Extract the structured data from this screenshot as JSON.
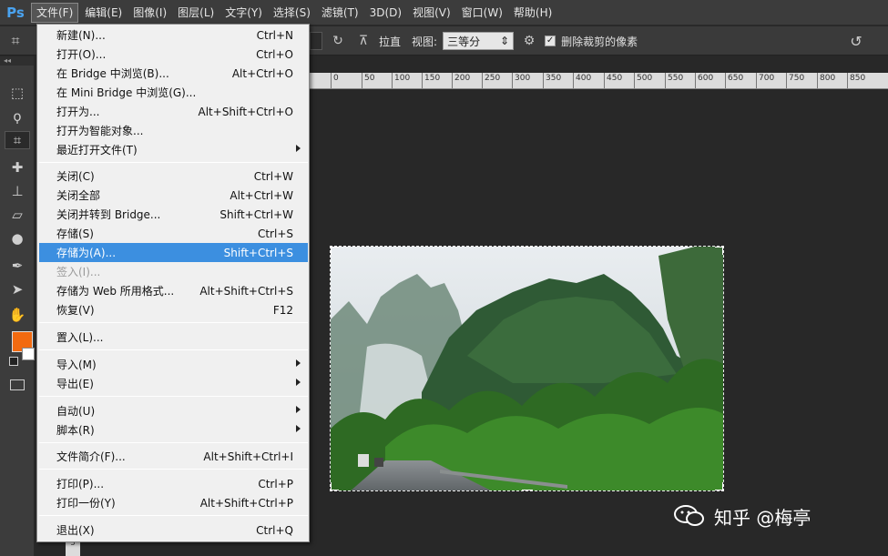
{
  "app": {
    "logo": "Ps"
  },
  "menubar": {
    "items": [
      "文件(F)",
      "编辑(E)",
      "图像(I)",
      "图层(L)",
      "文字(Y)",
      "选择(S)",
      "滤镜(T)",
      "3D(D)",
      "视图(V)",
      "窗口(W)",
      "帮助(H)"
    ],
    "active_index": 0
  },
  "options_bar": {
    "straighten_label": "拉直",
    "view_label": "视图:",
    "view_select_value": "三等分",
    "delete_cropped_label": "删除裁剪的像素",
    "delete_cropped_checked": true
  },
  "ruler": {
    "ticks": [
      "0",
      "50",
      "100",
      "150",
      "200",
      "250",
      "300",
      "350",
      "400",
      "450",
      "500",
      "550",
      "600",
      "650",
      "700",
      "750",
      "800",
      "850"
    ]
  },
  "vruler": {
    "label": "5"
  },
  "colors": {
    "foreground": "#f26a10",
    "background": "#ffffff",
    "menu_highlight": "#3c8fe0",
    "ps_logo": "#4aa3f0"
  },
  "file_menu": {
    "items": [
      {
        "label": "新建(N)...",
        "shortcut": "Ctrl+N"
      },
      {
        "label": "打开(O)...",
        "shortcut": "Ctrl+O"
      },
      {
        "label": "在 Bridge 中浏览(B)...",
        "shortcut": "Alt+Ctrl+O"
      },
      {
        "label": "在 Mini Bridge 中浏览(G)...",
        "shortcut": ""
      },
      {
        "label": "打开为...",
        "shortcut": "Alt+Shift+Ctrl+O"
      },
      {
        "label": "打开为智能对象...",
        "shortcut": ""
      },
      {
        "label": "最近打开文件(T)",
        "shortcut": "",
        "submenu": true
      },
      {
        "label": "关闭(C)",
        "shortcut": "Ctrl+W"
      },
      {
        "label": "关闭全部",
        "shortcut": "Alt+Ctrl+W"
      },
      {
        "label": "关闭并转到 Bridge...",
        "shortcut": "Shift+Ctrl+W"
      },
      {
        "label": "存储(S)",
        "shortcut": "Ctrl+S"
      },
      {
        "label": "存储为(A)...",
        "shortcut": "Shift+Ctrl+S",
        "highlighted": true
      },
      {
        "label": "签入(I)...",
        "shortcut": "",
        "disabled": true
      },
      {
        "label": "存储为 Web 所用格式...",
        "shortcut": "Alt+Shift+Ctrl+S"
      },
      {
        "label": "恢复(V)",
        "shortcut": "F12"
      },
      {
        "label": "置入(L)...",
        "shortcut": ""
      },
      {
        "label": "导入(M)",
        "shortcut": "",
        "submenu": true
      },
      {
        "label": "导出(E)",
        "shortcut": "",
        "submenu": true
      },
      {
        "label": "自动(U)",
        "shortcut": "",
        "submenu": true
      },
      {
        "label": "脚本(R)",
        "shortcut": "",
        "submenu": true
      },
      {
        "label": "文件简介(F)...",
        "shortcut": "Alt+Shift+Ctrl+I"
      },
      {
        "label": "打印(P)...",
        "shortcut": "Ctrl+P"
      },
      {
        "label": "打印一份(Y)",
        "shortcut": "Alt+Shift+Ctrl+P"
      },
      {
        "label": "退出(X)",
        "shortcut": "Ctrl+Q"
      }
    ]
  },
  "watermark": {
    "text": "知乎 @梅亭"
  }
}
